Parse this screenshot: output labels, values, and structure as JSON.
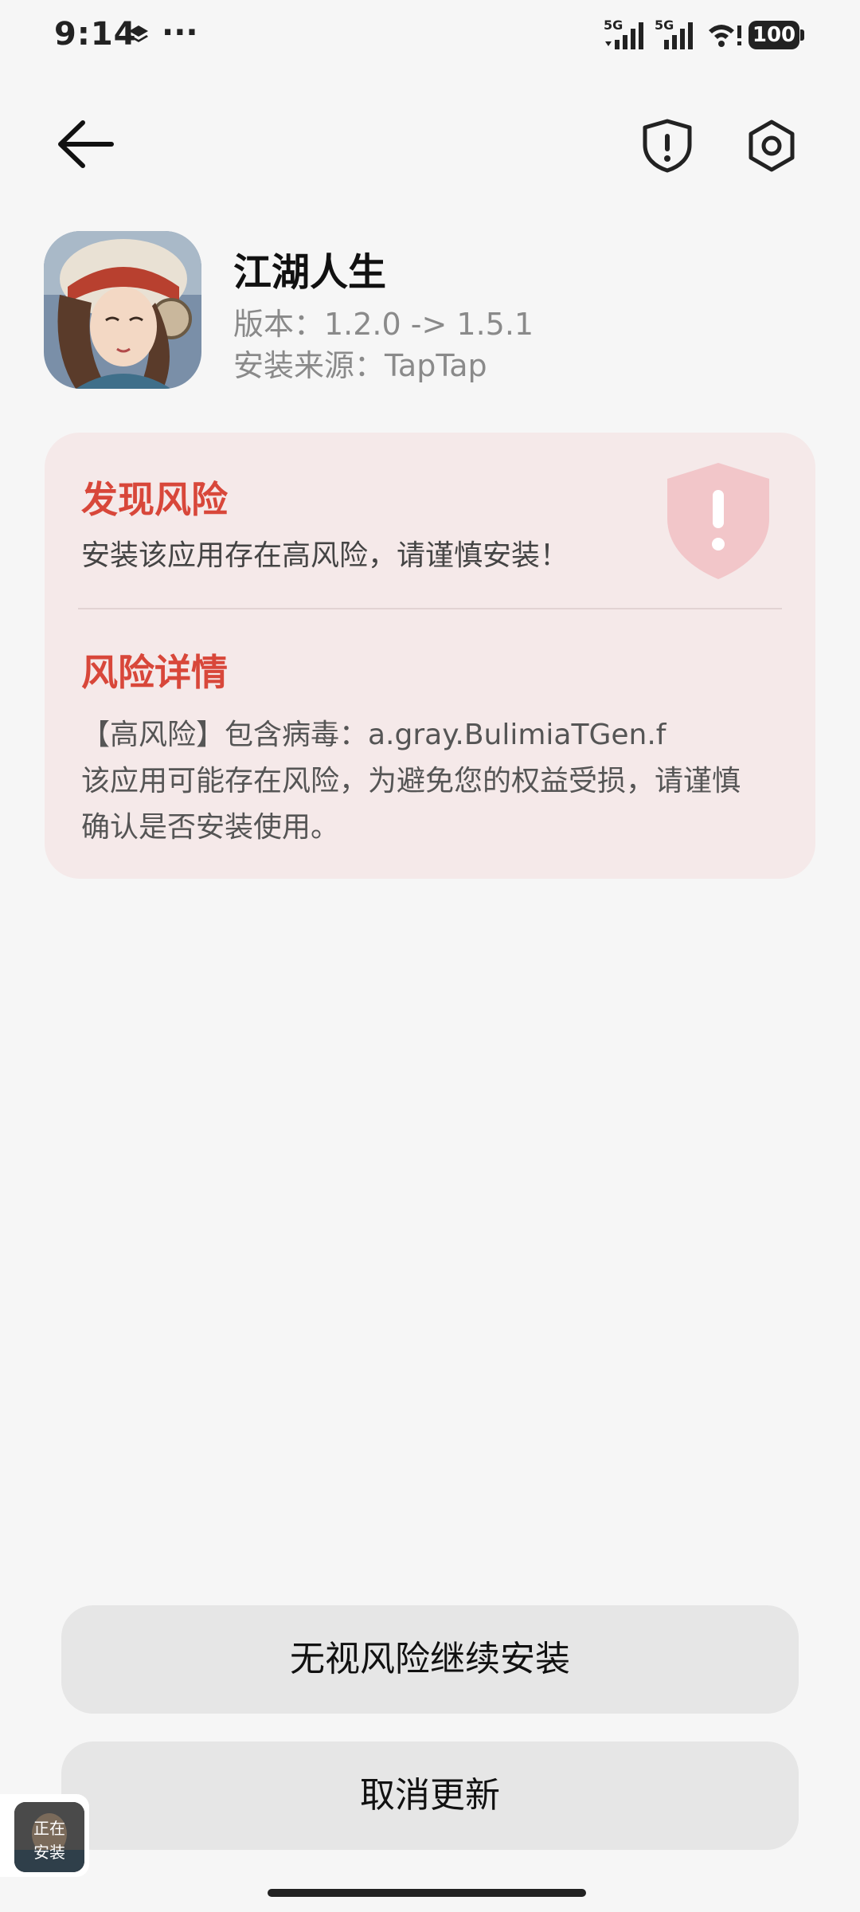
{
  "status_bar": {
    "time": "9:14",
    "more": "···",
    "net1": "5G",
    "net2": "5G",
    "battery": "100"
  },
  "app": {
    "name": "江湖人生",
    "version": "版本：1.2.0 -> 1.5.1",
    "source": "安装来源：TapTap"
  },
  "risk": {
    "title": "发现风险",
    "description": "安装该应用存在高风险，请谨慎安装！",
    "detail_title": "风险详情",
    "detail_lines": [
      "【高风险】包含病毒：a.gray.BulimiaTGen.f",
      "该应用可能存在风险，为避免您的权益受损，请谨慎",
      "确认是否安装使用。"
    ]
  },
  "buttons": {
    "continue": "无视风险继续安装",
    "cancel": "取消更新"
  },
  "installing": {
    "line1": "正在",
    "line2": "安装"
  },
  "colors": {
    "risk_red": "#d8473a",
    "card_bg": "#f5e9e9",
    "button_bg": "#e6e6e6",
    "page_bg": "#f6f6f6"
  }
}
